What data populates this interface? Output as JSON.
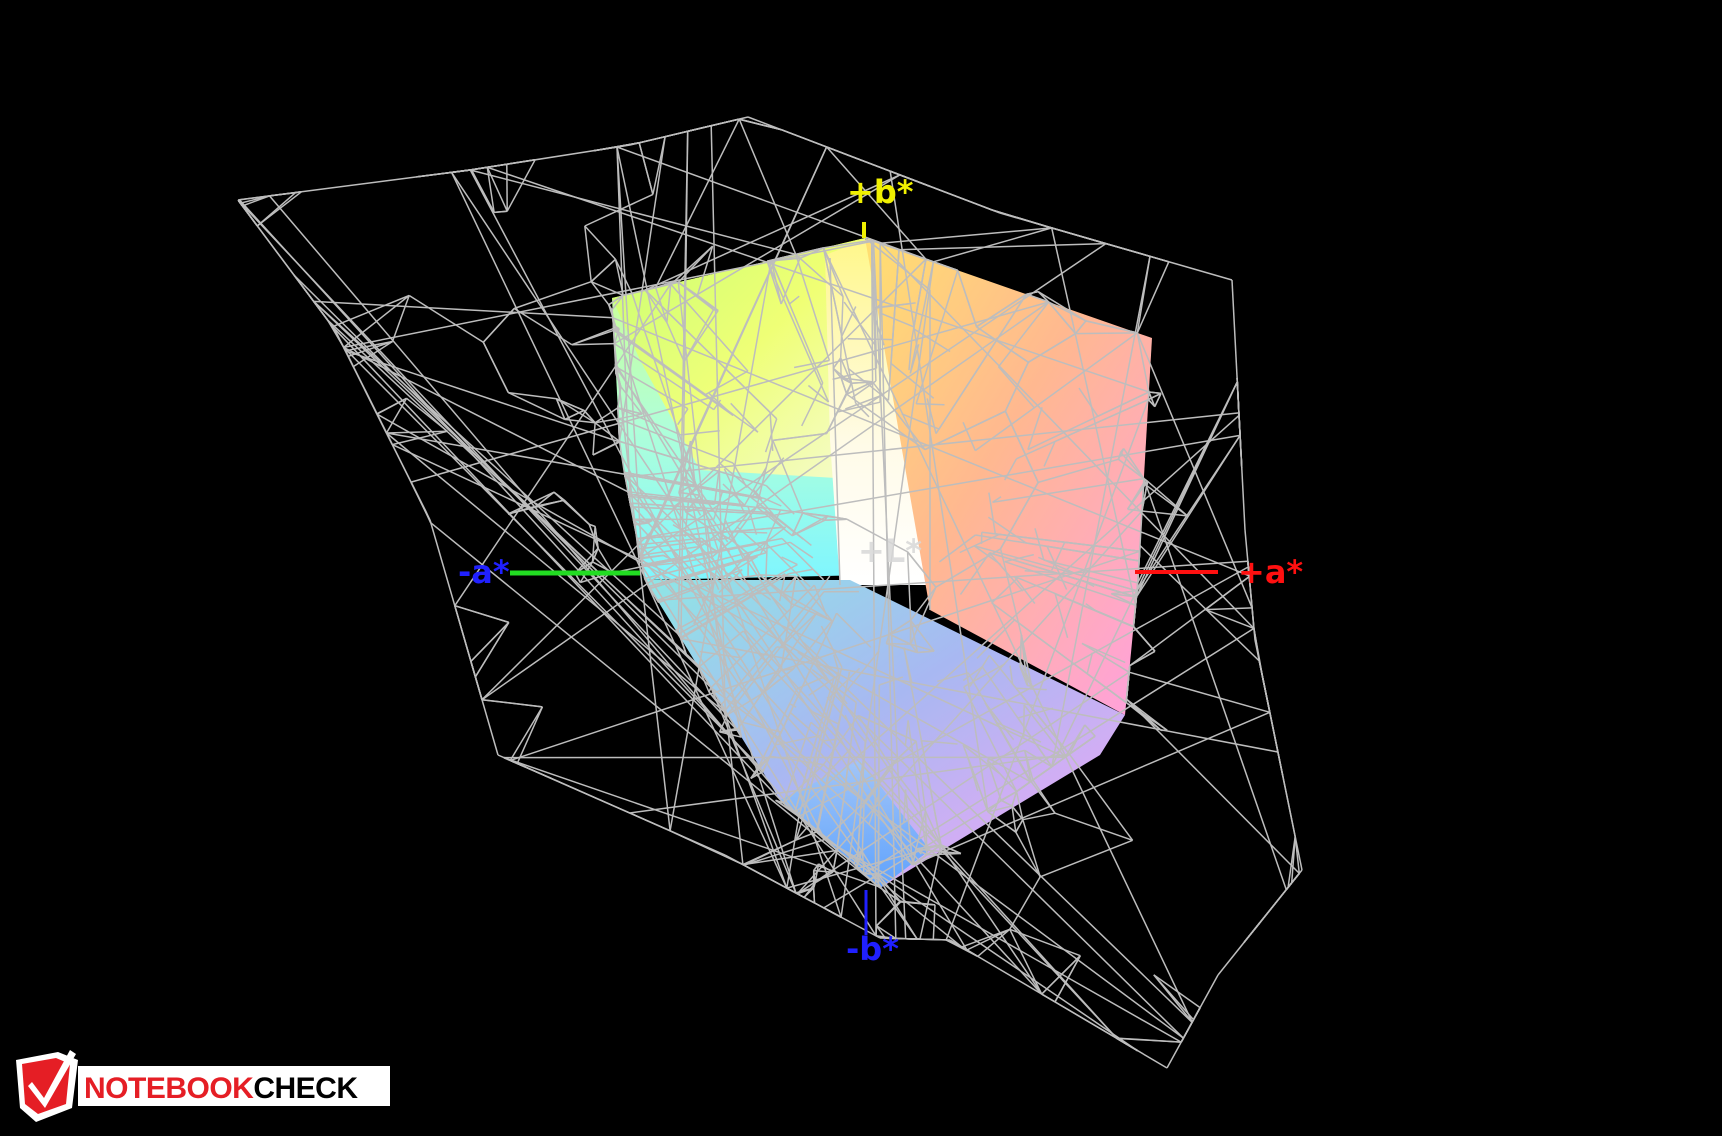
{
  "axes": {
    "plus_b": "+b*",
    "minus_b": "-b*",
    "plus_a": "+a*",
    "minus_a": "-a*",
    "plus_l": "+L*"
  },
  "logo": {
    "part1": "NOTEBOOK",
    "part2": "CHECK"
  },
  "colors": {
    "background": "#000000",
    "wireframe": "#bdbdbd",
    "axis_plus_b": "#f0f000",
    "axis_minus_b": "#2020ff",
    "axis_plus_a": "#ff1010",
    "axis_minus_a_line": "#22dd22",
    "axis_minus_a_label": "#2020ff",
    "axis_plus_l": "#d8d8d8",
    "logo_red": "#e51e25",
    "logo_white": "#ffffff"
  }
}
